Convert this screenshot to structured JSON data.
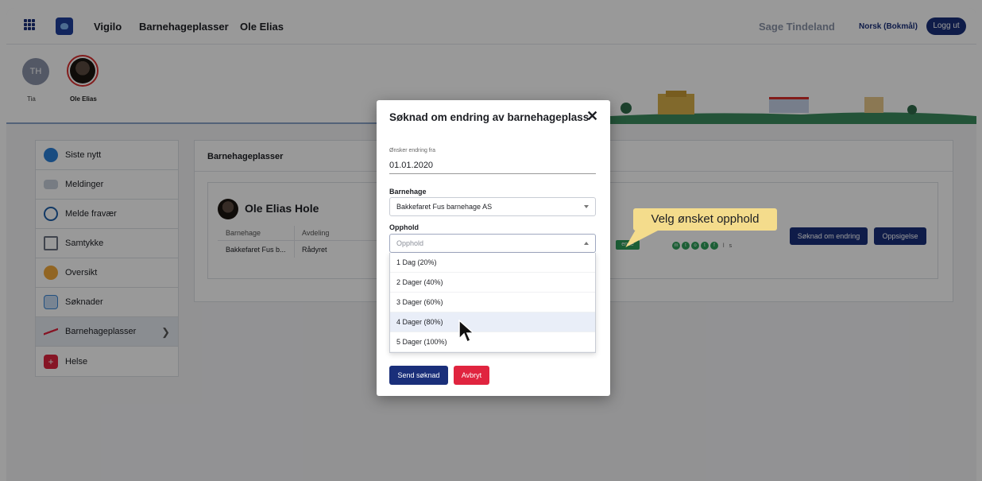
{
  "topbar": {
    "app_name": "Vigilo",
    "section": "Barnehageplasser",
    "child": "Ole Elias",
    "user": "Sage Tindeland",
    "language": "Norsk (Bokmål)",
    "logout": "Logg ut"
  },
  "kids": [
    {
      "initials": "TH",
      "name": "Tia"
    },
    {
      "name": "Ole Elias"
    }
  ],
  "sidebar": {
    "items": [
      {
        "label": "Siste nytt",
        "icon": "news-icon",
        "color": "#2b7fd8"
      },
      {
        "label": "Meldinger",
        "icon": "envelope-icon",
        "color": "#9aa7bd"
      },
      {
        "label": "Melde fravær",
        "icon": "clock-icon",
        "color": "#1f5fa8"
      },
      {
        "label": "Samtykke",
        "icon": "clipboard-icon",
        "color": "#6b7280"
      },
      {
        "label": "Oversikt",
        "icon": "child-face-icon",
        "color": "#f2a93b"
      },
      {
        "label": "Søknader",
        "icon": "application-search-icon",
        "color": "#3a86d6"
      },
      {
        "label": "Barnehageplasser",
        "icon": "seesaw-icon",
        "color": "#e0243f"
      },
      {
        "label": "Helse",
        "icon": "health-icon",
        "color": "#e0243f"
      }
    ]
  },
  "main": {
    "title": "Barnehageplasser",
    "card": {
      "name": "Ole Elias Hole",
      "headers": [
        "Barnehage",
        "Avdeling"
      ],
      "row": [
        "Bakkefaret Fus b...",
        "Rådyret"
      ],
      "badge": "ende",
      "dot_letters": [
        "m",
        "t",
        "o",
        "t",
        "f"
      ],
      "extra": [
        "l",
        "s"
      ],
      "btn_change": "Søknad om endring",
      "btn_cancel": "Oppsigelse"
    }
  },
  "modal": {
    "title": "Søknad om endring av barnehageplass",
    "close": "✕",
    "date_label": "Ønsker endring fra",
    "date_value": "01.01.2020",
    "kindergarten_label": "Barnehage",
    "kindergarten_value": "Bakkefaret Fus barnehage AS",
    "stay_label": "Opphold",
    "stay_placeholder": "Opphold",
    "options": [
      "1 Dag (20%)",
      "2 Dager (40%)",
      "3 Dager (60%)",
      "4 Dager (80%)",
      "5 Dager (100%)"
    ],
    "highlighted_option": 3,
    "send": "Send søknad",
    "cancel": "Avbryt"
  },
  "callout": "Velg ønsket opphold"
}
